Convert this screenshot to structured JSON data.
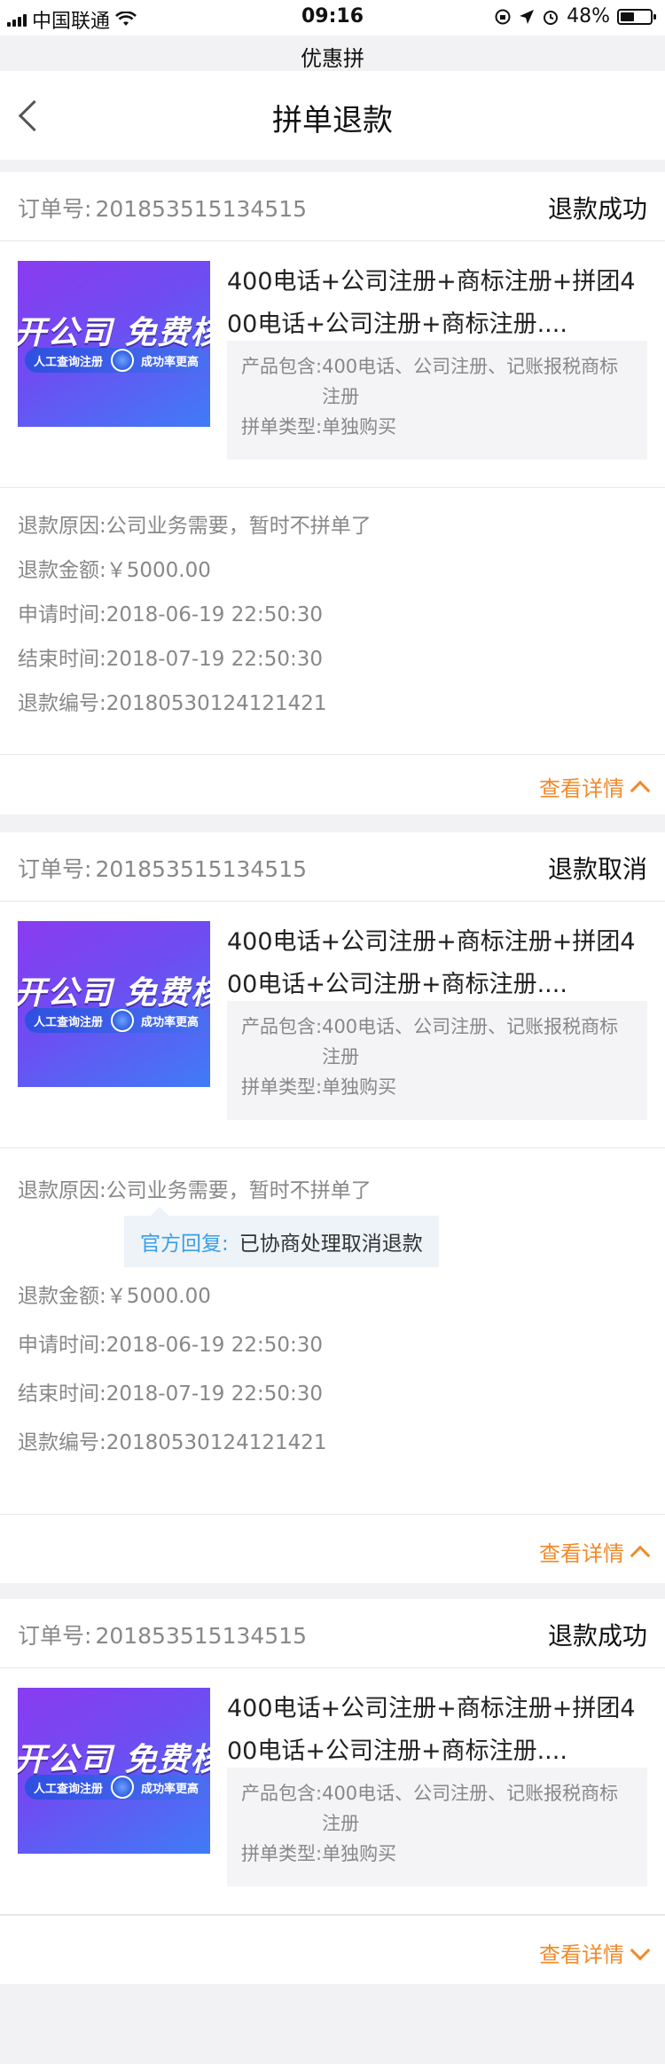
{
  "status_bar": {
    "carrier": "中国联通",
    "time": "09:16",
    "battery": "48%",
    "battery_fraction": 0.48
  },
  "app_subtitle": "优惠拼",
  "nav": {
    "title": "拼单退款"
  },
  "labels": {
    "order_no": "订单号:",
    "product_includes": "产品包含:",
    "group_type": "拼单类型:",
    "refund_reason": "退款原因:",
    "refund_amount": "退款金额:",
    "apply_time": "申请时间:",
    "end_time": "结束时间:",
    "refund_no": "退款编号:",
    "official_reply": "官方回复:",
    "view_details": "查看详情"
  },
  "thumbnail": {
    "title": "开公司 免费核名",
    "left_caption": "人工查询注册",
    "right_caption": "成功率更高"
  },
  "orders": [
    {
      "order_no": "201853515134515",
      "status": "退款成功",
      "product_title": "400电话+公司注册+商标注册+拼团400电话+公司注册+商标注册....",
      "includes": "400电话、公司注册、记账报税商标注册",
      "group_type": "单独购买",
      "reason": "公司业务需要，暂时不拼单了",
      "amount": "￥5000.00",
      "apply_time": "2018-06-19 22:50:30",
      "end_time": "2018-07-19 22:50:30",
      "refund_no": "20180530124121421"
    },
    {
      "order_no": "201853515134515",
      "status": "退款取消",
      "product_title": "400电话+公司注册+商标注册+拼团400电话+公司注册+商标注册....",
      "includes": "400电话、公司注册、记账报税商标注册",
      "group_type": "单独购买",
      "reason": "公司业务需要，暂时不拼单了",
      "reply": "已协商处理取消退款",
      "amount": "￥5000.00",
      "apply_time": "2018-06-19 22:50:30",
      "end_time": "2018-07-19 22:50:30",
      "refund_no": "20180530124121421"
    },
    {
      "order_no": "201853515134515",
      "status": "退款成功",
      "product_title": "400电话+公司注册+商标注册+拼团400电话+公司注册+商标注册....",
      "includes": "400电话、公司注册、记账报税商标注册",
      "group_type": "单独购买"
    }
  ],
  "colors": {
    "accent": "#f08a2a",
    "reply_label": "#3a9ee8",
    "page_bg": "#f2f2f4"
  }
}
